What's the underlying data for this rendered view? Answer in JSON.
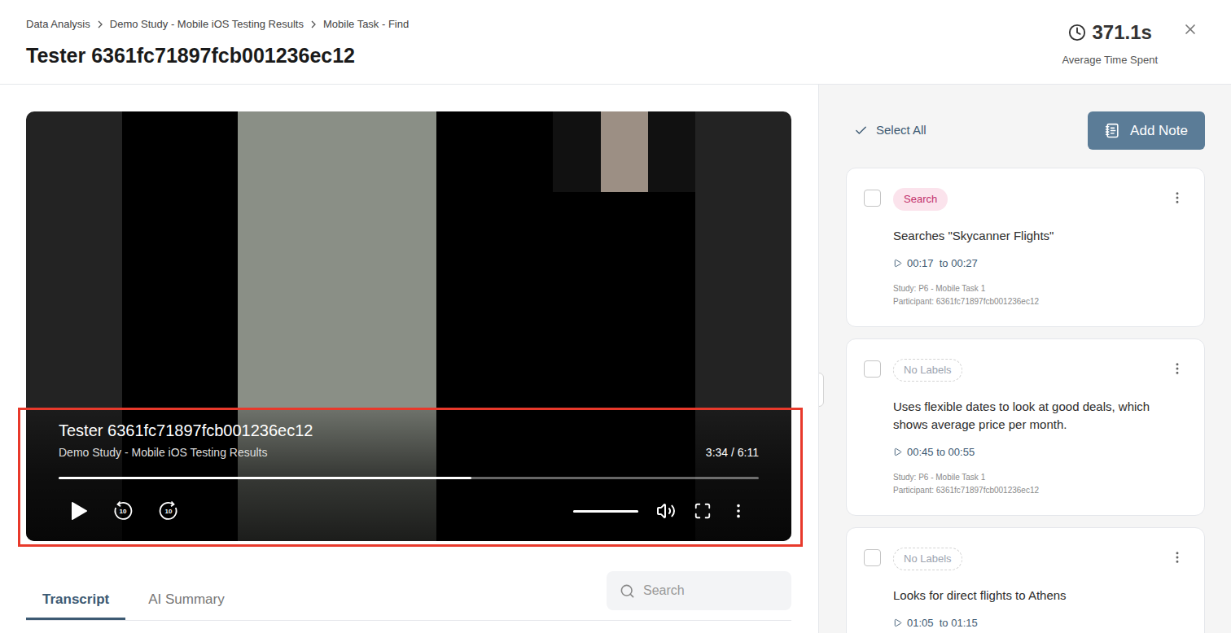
{
  "breadcrumb": [
    "Data Analysis",
    "Demo Study - Mobile iOS Testing Results",
    "Mobile Task - Find"
  ],
  "title": "Tester 6361fc71897fcb001236ec12",
  "timer": {
    "value": "371.1s",
    "label": "Average Time Spent"
  },
  "player": {
    "title": "Tester 6361fc71897fcb001236ec12",
    "subtitle": "Demo Study - Mobile iOS Testing Results",
    "time": "3:34 / 6:11",
    "progress": 0.59,
    "volume": 1,
    "playing": false,
    "rewind_label": "10",
    "forward_label": "10"
  },
  "tabs": [
    {
      "label": "Transcript",
      "selected": true
    },
    {
      "label": "AI Summary",
      "selected": false
    }
  ],
  "search": {
    "placeholder": "Search"
  },
  "sidebar": {
    "select_all": "Select All",
    "add_note": "Add Note"
  },
  "notes": [
    {
      "kind": "tag",
      "label": "Search",
      "checked": false,
      "text": "Searches \"Skycanner Flights\"",
      "range": "00:17  to 00:27",
      "study": "Study: P6 - Mobile Task 1",
      "participant": "Participant: 6361fc71897fcb001236ec12"
    },
    {
      "kind": "empty",
      "label": "No Labels",
      "checked": false,
      "text": "Uses flexible dates to look at good deals, which shows average price per month.",
      "range": "00:45 to 00:55",
      "study": "Study: P6 - Mobile Task 1",
      "participant": "Participant: 6361fc71897fcb001236ec12"
    },
    {
      "kind": "empty",
      "label": "No Labels",
      "checked": false,
      "text": "Looks for direct flights to Athens",
      "range": "01:05  to 01:15",
      "study": "",
      "participant": ""
    }
  ]
}
